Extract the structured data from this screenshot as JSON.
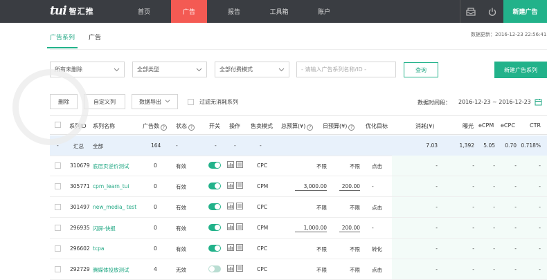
{
  "header": {
    "logo_mark": "tui",
    "logo_name": "智汇推",
    "nav": [
      "首页",
      "广告",
      "报告",
      "工具箱",
      "账户"
    ],
    "active_nav": 1,
    "new_ad_button": "新建广告"
  },
  "update_time": "数据更新：2016-12-23 22:56:41",
  "tabs": [
    "广告系列",
    "广告"
  ],
  "filters": {
    "status": "所有未删除",
    "type": "全部类型",
    "pay_mode": "全部付费模式",
    "search_placeholder": "- 请输入广告系列名称/ID -",
    "query_button": "查询",
    "new_series_button": "新建广告系列"
  },
  "actions": {
    "delete": "删除",
    "custom_col": "自定义列",
    "export": "数据导出",
    "filter_label": "过滤无消耗系列",
    "date_label": "数据时间段：",
    "date_range": "2016-12-23 ~ 2016-12-23"
  },
  "table": {
    "headers": {
      "id": "系列ID",
      "name": "系列名称",
      "ads": "广告数",
      "status": "状态",
      "switch": "开关",
      "ops": "操作",
      "mode": "售卖模式",
      "total_budget": "总预算(¥)",
      "daily_budget": "日预算(¥)",
      "optimize": "优化目标",
      "cost": "消耗(¥)",
      "impressions": "曝光",
      "ecpm": "eCPM",
      "ecpc": "eCPC",
      "ctr": "CTR"
    },
    "total": {
      "dash": "-",
      "label": "汇总",
      "name": "全部",
      "ads": "164",
      "status": "-",
      "switch": "-",
      "ops": "-",
      "mode": "-",
      "cost": "7.03",
      "impressions": "1,392",
      "ecpm": "5.05",
      "ecpc": "0.70",
      "ctr": "0.718%"
    },
    "rows": [
      {
        "id": "310679",
        "name": "底层页逆价测试",
        "ads": "0",
        "status": "有效",
        "on": true,
        "mode": "CPC",
        "total_budget": "不限",
        "daily_budget": "不限",
        "optimize": "点击",
        "cost": "-",
        "impressions": "-",
        "ecpm": "-",
        "ecpc": "-",
        "ctr": "-"
      },
      {
        "id": "305771",
        "name": "cpm_learn_tui",
        "ads": "0",
        "status": "有效",
        "on": true,
        "mode": "CPM",
        "total_budget": "3,000.00",
        "daily_budget": "200.00",
        "optimize": "-",
        "cost": "-",
        "impressions": "-",
        "ecpm": "-",
        "ecpc": "-",
        "ctr": "-"
      },
      {
        "id": "301497",
        "name": "new_media_ test",
        "ads": "0",
        "status": "有效",
        "on": true,
        "mode": "CPC",
        "total_budget": "不限",
        "daily_budget": "不限",
        "optimize": "点击",
        "cost": "-",
        "impressions": "-",
        "ecpm": "-",
        "ecpc": "-",
        "ctr": "-"
      },
      {
        "id": "296935",
        "name": "闪屏-快报",
        "ads": "0",
        "status": "有效",
        "on": true,
        "mode": "CPM",
        "total_budget": "1,000.00",
        "daily_budget": "200.00",
        "optimize": "-",
        "cost": "-",
        "impressions": "-",
        "ecpm": "-",
        "ecpc": "-",
        "ctr": "-"
      },
      {
        "id": "296602",
        "name": "tcpa",
        "ads": "0",
        "status": "有效",
        "on": true,
        "mode": "CPC",
        "total_budget": "不限",
        "daily_budget": "不限",
        "optimize": "转化",
        "cost": "-",
        "impressions": "-",
        "ecpm": "-",
        "ecpc": "-",
        "ctr": "-"
      },
      {
        "id": "292729",
        "name": "腾媒体投放测试",
        "ads": "4",
        "status": "无效",
        "on": false,
        "mode": "CPC",
        "total_budget": "不限",
        "daily_budget": "不限",
        "optimize": "点击",
        "cost": "-",
        "impressions": "-",
        "ecpm": "-",
        "ecpc": "-",
        "ctr": "-"
      }
    ]
  },
  "colors": {
    "accent": "#22b28a",
    "active_nav": "#f45a53",
    "topbar": "#3a3d42"
  }
}
